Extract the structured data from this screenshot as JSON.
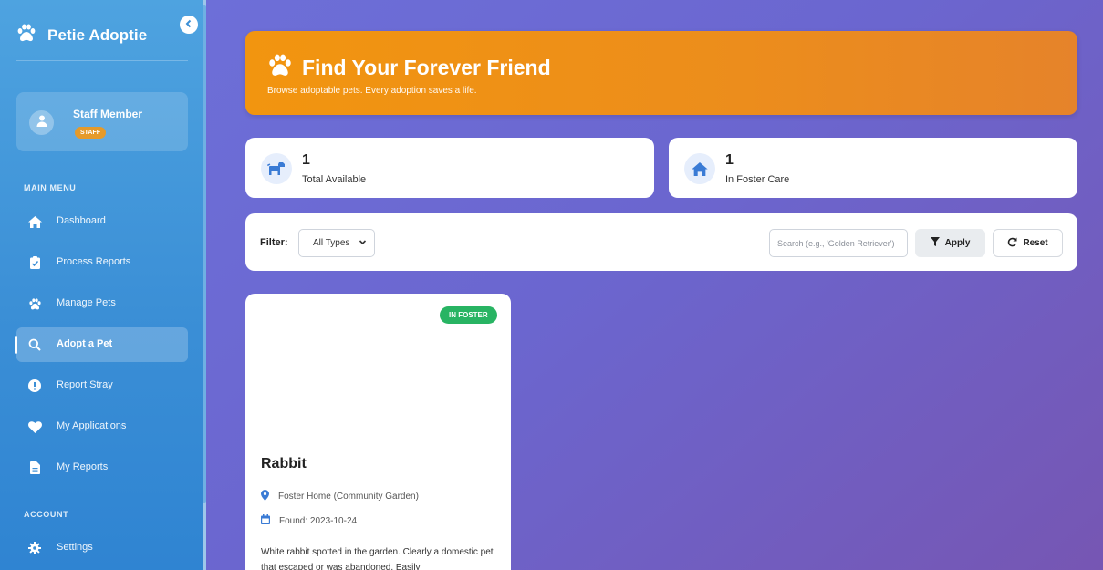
{
  "app": {
    "name": "Petie Adoptie"
  },
  "user": {
    "name": "Staff Member",
    "role": "STAFF"
  },
  "sidebar": {
    "main_menu_label": "MAIN MENU",
    "account_label": "ACCOUNT",
    "items": [
      {
        "label": "Dashboard",
        "icon": "home-icon"
      },
      {
        "label": "Process Reports",
        "icon": "clipboard-icon"
      },
      {
        "label": "Manage Pets",
        "icon": "paw-icon"
      },
      {
        "label": "Adopt a Pet",
        "icon": "search-icon",
        "active": true
      },
      {
        "label": "Report Stray",
        "icon": "alert-circle-icon"
      },
      {
        "label": "My Applications",
        "icon": "heart-icon"
      },
      {
        "label": "My Reports",
        "icon": "file-icon"
      }
    ],
    "account_items": [
      {
        "label": "Settings",
        "icon": "gear-icon"
      }
    ]
  },
  "hero": {
    "title": "Find Your Forever Friend",
    "subtitle": "Browse adoptable pets. Every adoption saves a life."
  },
  "stats": [
    {
      "value": "1",
      "label": "Total Available",
      "icon": "dog-icon"
    },
    {
      "value": "1",
      "label": "In Foster Care",
      "icon": "home-icon"
    }
  ],
  "filter": {
    "label": "Filter:",
    "type_selected": "All Types",
    "search_placeholder": "Search (e.g., 'Golden Retriever')",
    "apply_label": "Apply",
    "reset_label": "Reset"
  },
  "pets": [
    {
      "name": "Rabbit",
      "status": "IN FOSTER",
      "location": "Foster Home (Community Garden)",
      "found": "Found: 2023-10-24",
      "description": "White rabbit spotted in the garden. Clearly a domestic pet that escaped or was abandoned. Easily"
    }
  ],
  "colors": {
    "sidebar": "#3b8fd6",
    "hero": "#f2950f",
    "accent_blue": "#3a7bd5",
    "badge_staff": "#e59a2a",
    "badge_foster": "#28b463"
  }
}
